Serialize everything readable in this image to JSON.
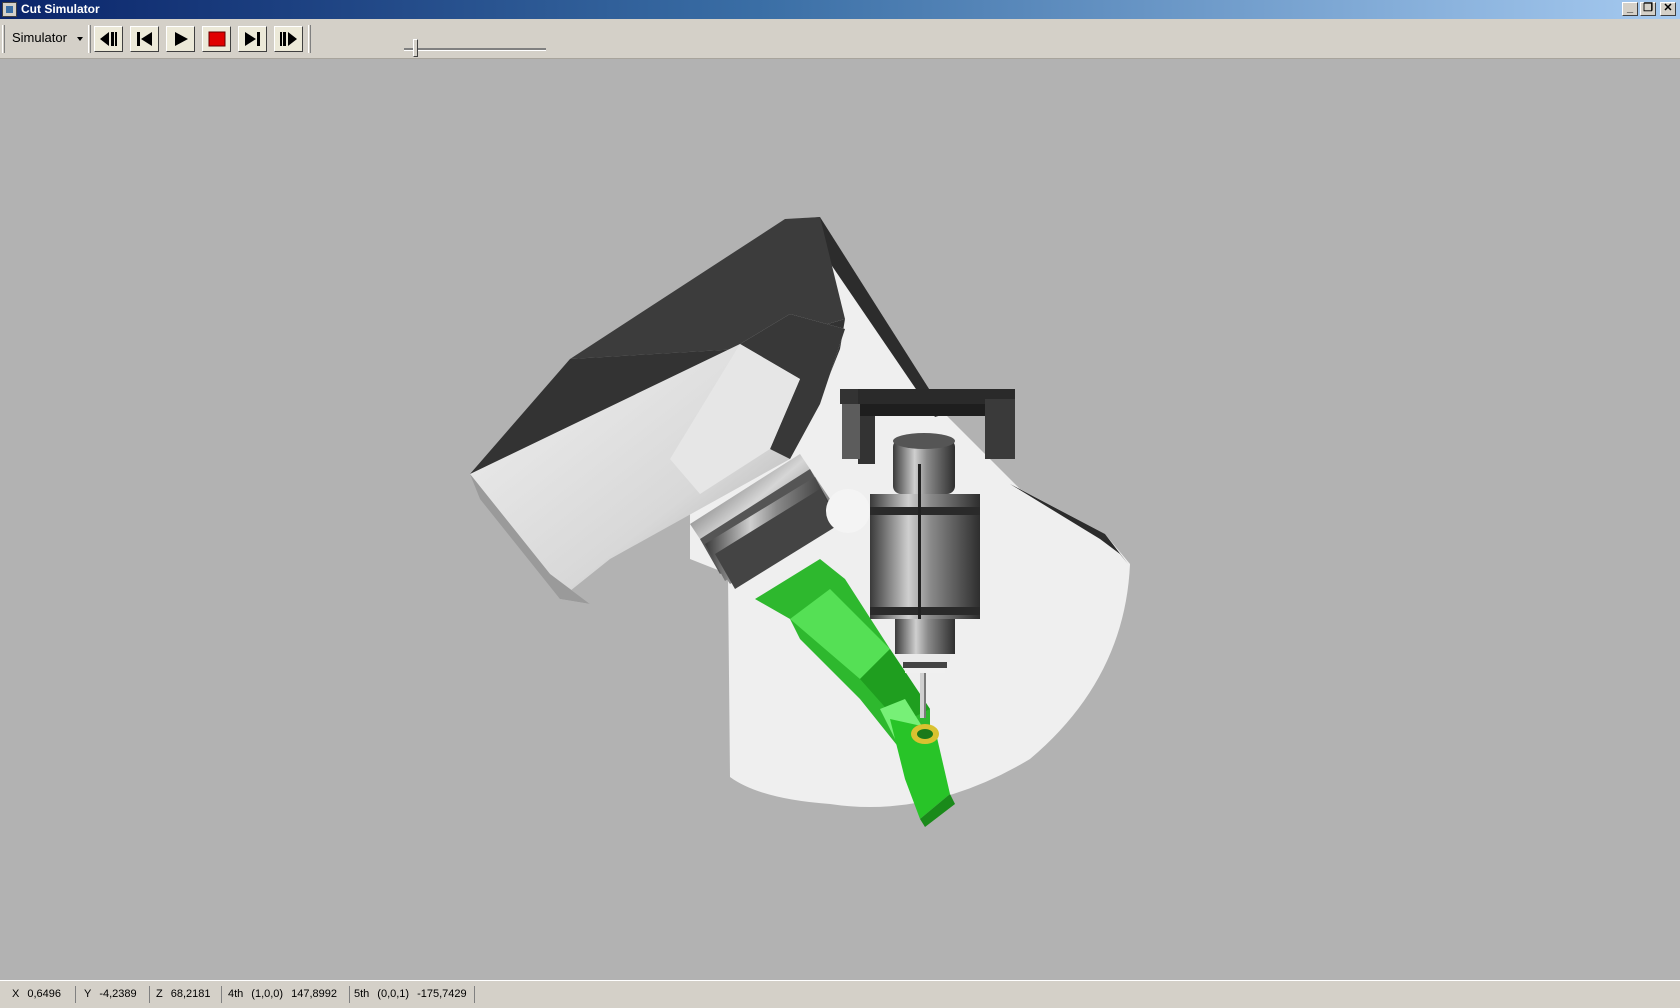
{
  "window": {
    "title": "Cut Simulator",
    "controls": {
      "minimize": "_",
      "restore": "❐",
      "close": "✕"
    }
  },
  "toolbar": {
    "menu_label": "Simulator",
    "buttons": [
      {
        "name": "step-back-button",
        "icon": "step-back-icon"
      },
      {
        "name": "go-to-start-button",
        "icon": "go-to-start-icon"
      },
      {
        "name": "play-button",
        "icon": "play-icon"
      },
      {
        "name": "stop-button",
        "icon": "stop-icon"
      },
      {
        "name": "go-to-end-button",
        "icon": "go-to-end-icon"
      },
      {
        "name": "step-forward-button",
        "icon": "step-forward-icon"
      }
    ],
    "speed_slider_value": 0.08
  },
  "status": {
    "x_label": "X",
    "x_value": "0,6496",
    "y_label": "Y",
    "y_value": "-4,2389",
    "z_label": "Z",
    "z_value": "68,2181",
    "a4_label": "4th",
    "a4_axis": "(1,0,0)",
    "a4_value": "147,8992",
    "a5_label": "5th",
    "a5_axis": "(0,0,1)",
    "a5_value": "-175,7429"
  },
  "colors": {
    "viewport_bg": "#b2b2b2",
    "titlebar_start": "#0a246a",
    "titlebar_end": "#a6caf0",
    "workpiece_green": "#33cc33",
    "stop_red": "#e00000"
  }
}
